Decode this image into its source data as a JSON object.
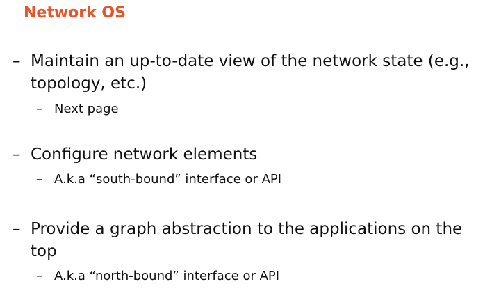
{
  "slide": {
    "title": "Network OS",
    "dash": "–",
    "bullets": [
      {
        "line1": "Maintain an up-to-date view of the network state (e.g.,",
        "line2": "topology, etc.)",
        "sub": "Next page"
      },
      {
        "line1": "Configure network elements",
        "sub": "A.k.a “south-bound” interface or API"
      },
      {
        "line1": "Provide a graph abstraction to the applications on the",
        "line2": "top",
        "sub": "A.k.a “north-bound” interface or API"
      }
    ]
  }
}
